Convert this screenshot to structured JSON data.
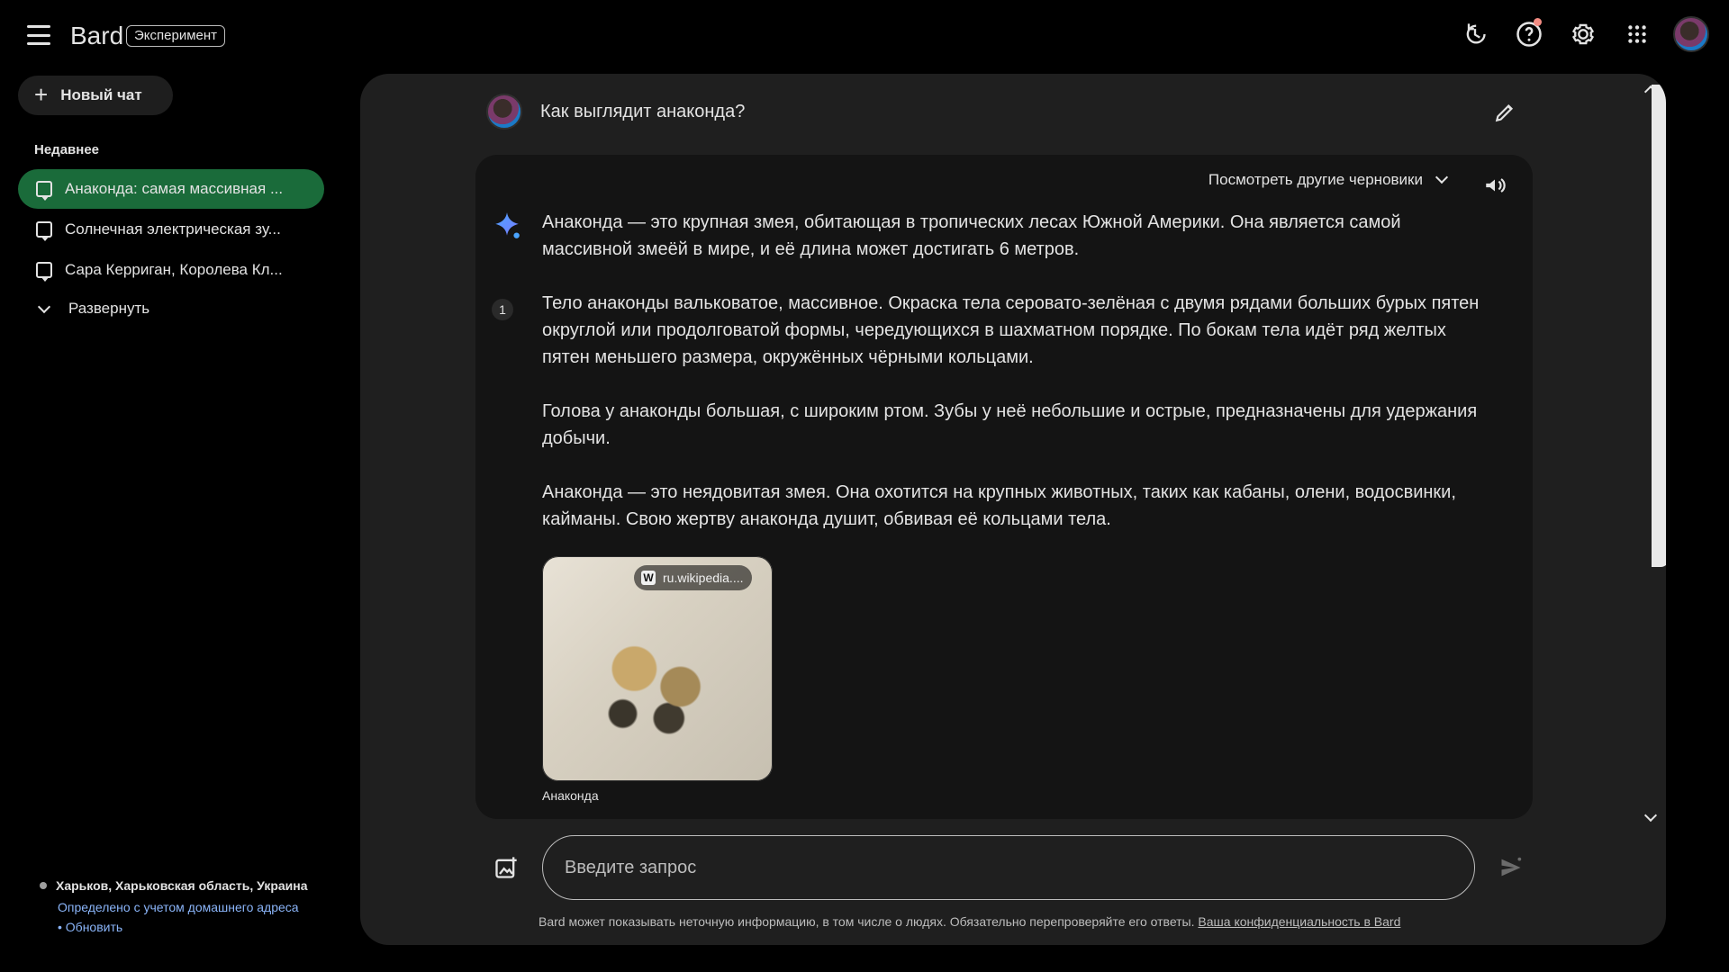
{
  "app": {
    "brand": "Bard",
    "badge": "Эксперимент",
    "colors": {
      "accent": "#1a6b3a",
      "panel": "#1f1f1f",
      "card": "#141414",
      "text": "#e3e3e3",
      "link": "#8ab4f8"
    }
  },
  "topbar": {
    "icons": [
      "history-icon",
      "help-icon",
      "settings-icon",
      "apps-icon",
      "avatar"
    ]
  },
  "sidebar": {
    "new_chat_label": "Новый чат",
    "recent_title": "Недавнее",
    "items": [
      {
        "label": "Анаконда: самая массивная ...",
        "active": true
      },
      {
        "label": "Солнечная электрическая зу...",
        "active": false
      },
      {
        "label": "Сара Керриган, Королева Кл...",
        "active": false
      }
    ],
    "expand_label": "Развернуть",
    "location": {
      "city": "Харьков, Харьковская область, Украина",
      "basis": "Определено с учетом домашнего адреса",
      "update": "• Обновить"
    }
  },
  "chat": {
    "user_prompt": "Как выглядит анаконда?",
    "drafts_label": "Посмотреть другие черновики",
    "citation_number": "1",
    "answer": {
      "p1": "Анаконда — это крупная змея, обитающая в тропических лесах Южной Америки. Она является самой массивной змеёй в мире, и её длина может достигать 6 метров.",
      "p2": "Тело анаконды вальковатое, массивное. Окраска тела серовато-зелёная с двумя рядами больших бурых пятен округлой или продолговатой формы, чередующихся в шахматном порядке. По бокам тела идёт ряд желтых пятен меньшего размера, окружённых чёрными кольцами.",
      "p3": "Голова у анаконды большая, с широким ртом. Зубы у неё небольшие и острые, предназначены для удержания добычи.",
      "p4": "Анаконда — это неядовитая змея. Она охотится на крупных животных, таких как кабаны, олени, водосвинки, кайманы. Свою жертву анаконда душит, обвивая её кольцами тела."
    },
    "image": {
      "source": "ru.wikipedia....",
      "caption": "Анаконда"
    }
  },
  "input": {
    "placeholder": "Введите запрос"
  },
  "footer": {
    "disclaimer": "Bard может показывать неточную информацию, в том числе о людях. Обязательно перепроверяйте его ответы.",
    "privacy_link": "Ваша конфиденциальность в Bard"
  }
}
